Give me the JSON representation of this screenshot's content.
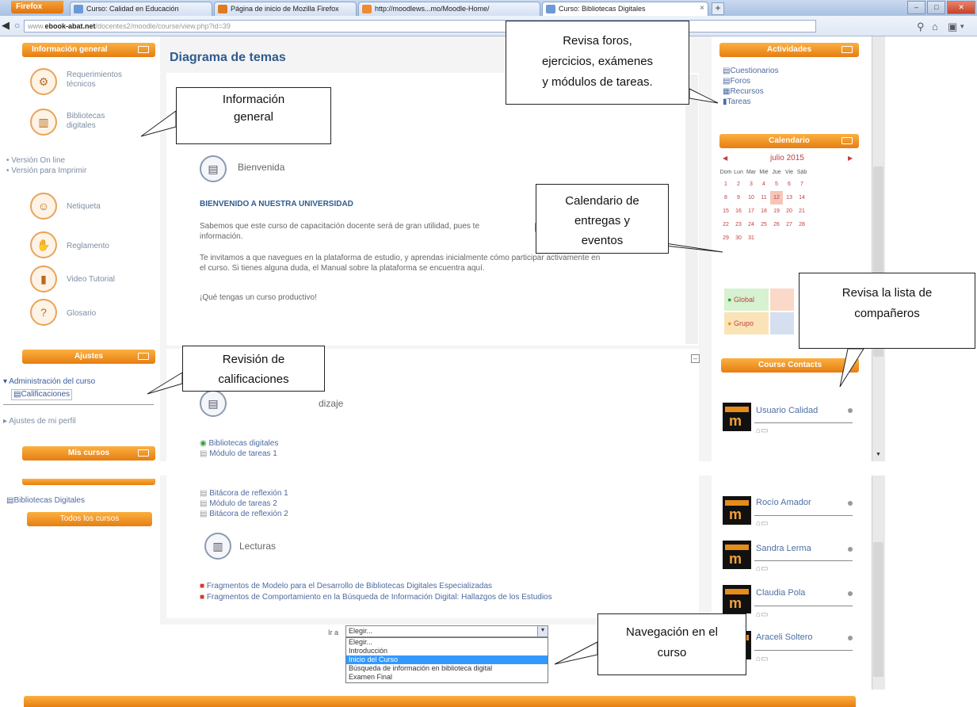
{
  "browser": {
    "menu_button": "Firefox",
    "tabs": [
      {
        "label": "Curso: Calidad en Educación",
        "color": "#6b9ad6"
      },
      {
        "label": "Página de inicio de Mozilla Firefox",
        "color": "#e07a1f"
      },
      {
        "label": "http://moodlews...mo/Moodle-Home/",
        "color": "#f08a30"
      },
      {
        "label": "Curso: Bibliotecas Digitales",
        "color": "#6b9ad6"
      }
    ],
    "new_tab": "+",
    "url_domain": "ebook-abat.net",
    "url_prefix": "www.",
    "url_rest": "/docentes2/moodle/course/view.php?id=39"
  },
  "left": {
    "info_block_title": "Información general",
    "info_items": [
      {
        "label": "Requerimientos técnicos",
        "icon": "gears-icon"
      },
      {
        "label": "Bibliotecas digitales",
        "icon": "books-icon"
      }
    ],
    "version_links": [
      "Versión On line",
      "Versión para Imprimir"
    ],
    "info_items2": [
      {
        "label": "Netiqueta",
        "icon": "netiquette-icon"
      },
      {
        "label": "Reglamento",
        "icon": "handshake-icon"
      },
      {
        "label": "Video Tutorial",
        "icon": "film-icon"
      },
      {
        "label": "Glosario",
        "icon": "question-icon"
      }
    ],
    "settings_title": "Ajustes",
    "admin_label": "Administración del curso",
    "grades_label": "Calificaciones",
    "profile_label": "Ajustes de mi perfil",
    "mycourses_title": "Mis cursos",
    "mycourses_item": "Bibliotecas Digitales",
    "all_courses": "Todos los cursos"
  },
  "main": {
    "title": "Diagrama de temas",
    "welcome_label": "Bienvenida",
    "welcome_heading": "BIENVENIDO A NUESTRA UNIVERSIDAD",
    "p1a": "Sabemos que este curso de capacitación docente será de gran utilidad, pues te",
    "p1b": "información.",
    "p2a": "Te invitamos a que navegues en la plataforma de estudio, y aprendas inicialmente cómo participar activamente en",
    "p2b": "el curso. Si tienes alguna duda, el Manual sobre la plataforma se encuentra aquí.",
    "p3": "¡Qué tengas un curso productivo!",
    "section2_title_tail": "dizaje",
    "resources_top": [
      "Bibliotecas digitales",
      "Módulo de tareas 1"
    ],
    "resources_bottom": [
      "Bitácora de reflexión 1",
      "Módulo de tareas 2",
      "Bitácora de reflexión 2"
    ],
    "readings_label": "Lecturas",
    "pdfs": [
      "Fragmentos de Modelo para el Desarrollo de Bibliotecas Digitales Especializadas",
      "Fragmentos de Comportamiento en la Búsqueda de Información Digital: Hallazgos de los Estudios"
    ],
    "jump_label": "Ir a",
    "jump_selected": "Elegir...",
    "jump_options": [
      "Elegir...",
      "Introducción",
      "Inicio del Curso",
      "Búsqueda de información en biblioteca digital",
      "Examen Final"
    ]
  },
  "right": {
    "activities_title": "Actividades",
    "activities": [
      "Cuestionarios",
      "Foros",
      "Recursos",
      "Tareas"
    ],
    "calendar_title": "Calendario",
    "calendar_month": "julio 2015",
    "calendar_days": [
      "Dom",
      "Lun",
      "Mar",
      "Mié",
      "Jue",
      "Vie",
      "Sáb"
    ],
    "calendar_weeks": [
      [
        "",
        "",
        "",
        "1",
        "2",
        "3",
        "4"
      ],
      [
        "5",
        "6",
        "7",
        "8",
        "9",
        "10",
        "11"
      ],
      [
        "12",
        "13",
        "14",
        "15",
        "16",
        "17",
        "18"
      ],
      [
        "19",
        "20",
        "21",
        "22",
        "23",
        "24",
        "25"
      ],
      [
        "26",
        "27",
        "28",
        "29",
        "30",
        "31",
        ""
      ]
    ],
    "calendar_weeks_shown": [
      [
        "1",
        "2",
        "3",
        "4",
        "5",
        "6",
        "7"
      ],
      [
        "8",
        "9",
        "10",
        "11",
        "12",
        "13",
        "14"
      ],
      [
        "15",
        "16",
        "17",
        "18",
        "19",
        "20",
        "21"
      ],
      [
        "22",
        "23",
        "24",
        "25",
        "26",
        "27",
        "28"
      ],
      [
        "29",
        "30",
        "31",
        "",
        "",
        "",
        ""
      ]
    ],
    "legend": [
      "Global",
      "Grupo"
    ],
    "contacts_title": "Course Contacts",
    "contacts": [
      "Usuario Calidad",
      "Rocío Amador",
      "Sandra Lerma",
      "Claudia Pola",
      "Araceli Soltero"
    ]
  },
  "callouts": {
    "info": [
      "Información",
      "general"
    ],
    "foros": [
      "Revisa foros,",
      "ejercicios, exámenes",
      "y módulos de tareas."
    ],
    "calendario": [
      "Calendario de",
      "entregas y",
      "eventos"
    ],
    "companeros": [
      "Revisa la lista de",
      "compañeros"
    ],
    "calificaciones": [
      "Revisión de",
      "calificaciones"
    ],
    "navegacion": [
      "Navegación en el",
      "curso"
    ]
  },
  "colors": {
    "accent": "#f08c1c",
    "link": "#4f6aa1"
  }
}
